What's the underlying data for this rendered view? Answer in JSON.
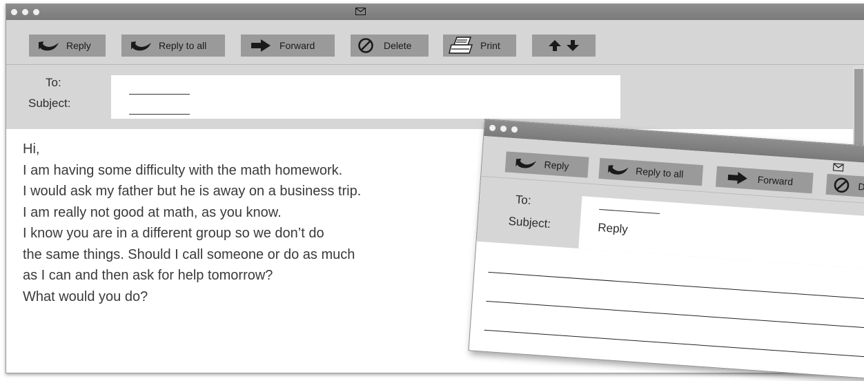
{
  "main_window": {
    "toolbar": {
      "reply_label": "Reply",
      "reply_all_label": "Reply to all",
      "forward_label": "Forward",
      "delete_label": "Delete",
      "print_label": "Print"
    },
    "header": {
      "to_label": "To:",
      "subject_label": "Subject:"
    },
    "body_lines": [
      "Hi,",
      "I am having some difficulty with the math homework.",
      "I would ask my father but he is away on a business trip.",
      "I am really not good at math, as you know.",
      "I know you are in a different group so we don’t do",
      "the same things. Should I call someone or do as much",
      "as I can and then ask for help tomorrow?",
      "What would you do?"
    ]
  },
  "reply_window": {
    "toolbar": {
      "reply_label": "Reply",
      "reply_all_label": "Reply to all",
      "forward_label": "Forward",
      "delete_label": "D"
    },
    "header": {
      "to_label": "To:",
      "subject_label": "Subject:",
      "subject_value": "Reply"
    }
  },
  "icons": {
    "envelope": "envelope-icon",
    "reply": "reply-arrow-icon",
    "forward": "forward-arrow-icon",
    "delete": "no-symbol-icon",
    "print": "printer-icon",
    "prev": "up-arrow-icon",
    "next": "down-arrow-icon"
  },
  "colors": {
    "titlebar": "#808080",
    "toolbar": "#d6d6d6",
    "button": "#9a9a9a",
    "icon": "#1a1a1a",
    "text": "#3a3a3a"
  }
}
